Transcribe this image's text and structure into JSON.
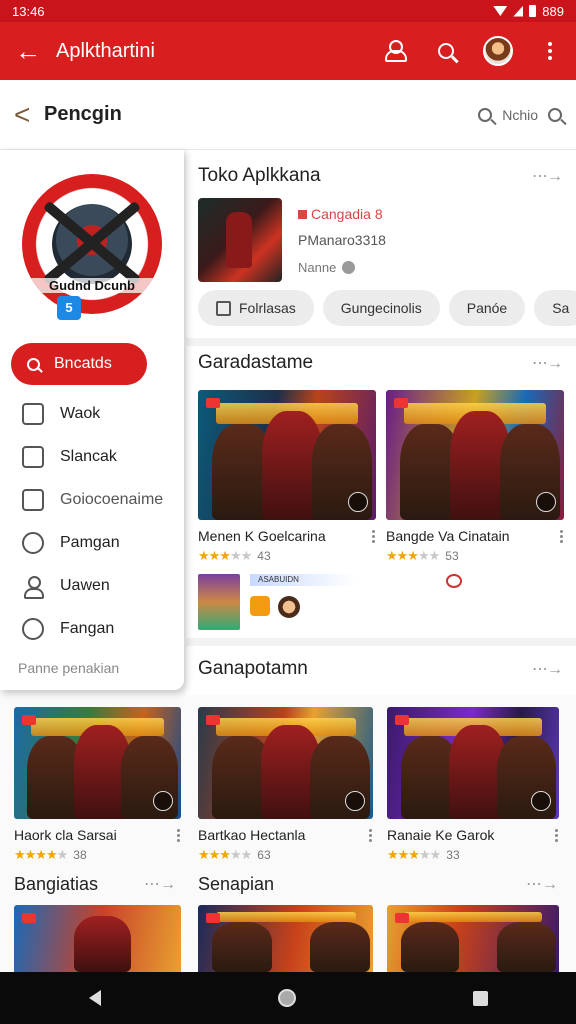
{
  "status_bar": {
    "time": "13:46",
    "right_text": "889"
  },
  "app_bar": {
    "title": "Aplkthartini"
  },
  "page": {
    "back_glyph": "<",
    "title": "Pencgin",
    "search_text": "Nchio"
  },
  "drawer": {
    "logo_text": "Gudnd Dcunb",
    "badge_text": "5",
    "primary_button": "Bncatds",
    "items": [
      {
        "label": "Waok",
        "icon": "thumb-up-icon"
      },
      {
        "label": "Slancak",
        "icon": "list-icon"
      },
      {
        "label": "Goiocoenaime",
        "icon": "document-icon"
      },
      {
        "label": "Pamgan",
        "icon": "group-icon"
      },
      {
        "label": "Uawen",
        "icon": "person-icon"
      },
      {
        "label": "Fangan",
        "icon": "circle-icon"
      }
    ],
    "footer": "Panne penakian"
  },
  "store": {
    "title": "Toko Aplkkana",
    "more": "⋯→",
    "featured": {
      "name": "Cangadia 8",
      "developer": "PManaro3318",
      "subtitle": "Nanne"
    },
    "chips": [
      "Folrlasas",
      "Gungecinolis",
      "Panóe",
      "Sa"
    ]
  },
  "sections": [
    {
      "title": "Garadastame"
    },
    {
      "title": "Ganapotamn"
    },
    {
      "title": "Bangiatias"
    },
    {
      "title": "Senapian"
    }
  ],
  "row1_games": [
    {
      "name": "Menen K Goelcarina",
      "stars": 3,
      "count": "43"
    },
    {
      "name": "Bangde Va Cinatain",
      "stars": 3,
      "count": "53"
    }
  ],
  "mini": {
    "bar_text": "ASABUIDN"
  },
  "row2_games": [
    {
      "name": "Haork cla Sarsai",
      "stars": 4,
      "count": "38"
    },
    {
      "name": "Bartkao Hectanla",
      "stars": 3,
      "count": "63"
    },
    {
      "name": "Ranaie Ke Garok",
      "stars": 3,
      "count": "33"
    }
  ],
  "colors": {
    "brand_red": "#d81e1e",
    "status_red": "#c8141a",
    "star": "#f0a500"
  }
}
